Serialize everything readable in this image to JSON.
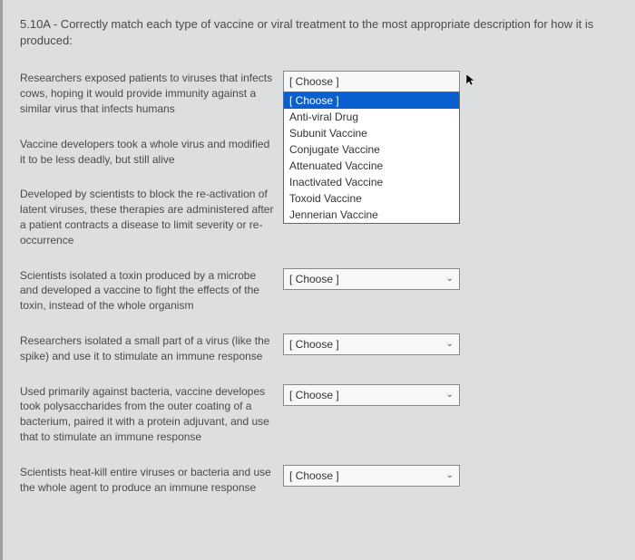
{
  "question": "5.10A - Correctly match each type of vaccine or viral treatment to the most appropriate description for how it is produced:",
  "choose_label": "[ Choose ]",
  "rows": [
    {
      "desc": "Researchers exposed patients to viruses that infects cows, hoping it would provide immunity against a similar virus that infects humans"
    },
    {
      "desc": "Vaccine developers took a whole virus and modified it to be less deadly, but still alive"
    },
    {
      "desc": "Developed by scientists to block the re-activation of latent viruses, these therapies are administered after a patient contracts a disease to limit severity or re-occurrence"
    },
    {
      "desc": "Scientists isolated a toxin produced by a microbe and developed a vaccine to fight the effects of the toxin, instead of the whole organism"
    },
    {
      "desc": "Researchers isolated a small part of a virus (like the spike) and use it to stimulate an immune response"
    },
    {
      "desc": "Used primarily against bacteria, vaccine developes took polysaccharides from the outer coating of a bacterium, paired it with a protein adjuvant, and use that to stimulate an immune response"
    },
    {
      "desc": "Scientists heat-kill entire viruses or bacteria and use the whole agent to produce an immune response"
    }
  ],
  "dropdown_options": [
    "[ Choose ]",
    "Anti-viral Drug",
    "Subunit Vaccine",
    "Conjugate Vaccine",
    "Attenuated Vaccine",
    "Inactivated Vaccine",
    "Toxoid Vaccine",
    "Jennerian Vaccine"
  ]
}
